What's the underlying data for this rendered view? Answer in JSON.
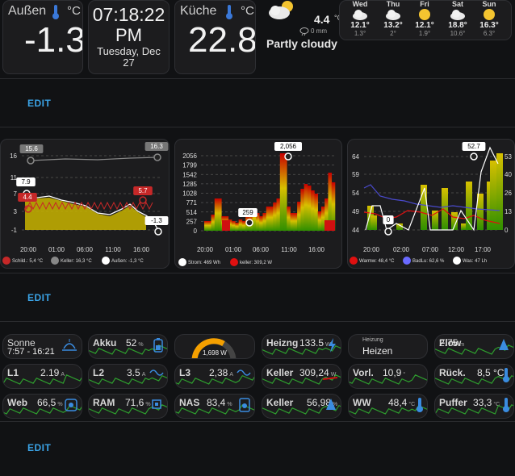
{
  "top": {
    "outdoor": {
      "label": "Außen",
      "unit": "°C",
      "value": "-1.3"
    },
    "clock": {
      "time": "07:18:22",
      "ampm": "PM",
      "date": "Tuesday, Dec",
      "day": "27"
    },
    "kitchen": {
      "label": "Küche",
      "unit": "°C",
      "value": "22.8"
    },
    "weather": {
      "temp": "4.4",
      "temp_unit": "°C",
      "precip": "0 mm",
      "condition": "Partly cloudy",
      "forecast": [
        {
          "day": "Wed",
          "hi": "12.1°",
          "lo": "1.3°",
          "icon": "cloudy-icon"
        },
        {
          "day": "Thu",
          "hi": "13.2°",
          "lo": "2°",
          "icon": "cloudy-icon"
        },
        {
          "day": "Fri",
          "hi": "12.1°",
          "lo": "1.9°",
          "icon": "sunny-icon"
        },
        {
          "day": "Sat",
          "hi": "18.8°",
          "lo": "10.6°",
          "icon": "cloudy-icon"
        },
        {
          "day": "Sun",
          "hi": "16.3°",
          "lo": "6.3°",
          "icon": "sunny-icon"
        }
      ]
    }
  },
  "edit_label": "EDIT",
  "charts": [
    {
      "yticks": [
        "16",
        "11",
        "7",
        "3",
        "-1"
      ],
      "xticks": [
        "20:00",
        "01:00",
        "06:00",
        "11:00",
        "16:00"
      ],
      "badges": [
        "15.6",
        "16.3",
        "7.9",
        "4.4",
        "5.7",
        "-1.3"
      ],
      "legend": [
        {
          "label": "Schild.: 5,4 °C",
          "color": "#c62828"
        },
        {
          "label": "Keller: 16,3 °C",
          "color": "#888888"
        },
        {
          "label": "Außen: -1,3 °C",
          "color": "#ffffff"
        }
      ]
    },
    {
      "yticks": [
        "2056",
        "1799",
        "1542",
        "1285",
        "1028",
        "771",
        "514",
        "257",
        "0"
      ],
      "xticks": [
        "20:00",
        "01:00",
        "06:00",
        "11:00",
        "16:00"
      ],
      "badges": [
        "2,056",
        "259"
      ],
      "legend": [
        {
          "label": "Strom: 469 Wh",
          "color": "#ffffff"
        },
        {
          "label": "keller: 309,2 W",
          "color": "#e01010"
        }
      ]
    },
    {
      "yticks_left": [
        "64",
        "59",
        "54",
        "49",
        "44"
      ],
      "yticks_right": [
        "53",
        "40",
        "26",
        "13",
        "0"
      ],
      "xticks": [
        "20:00",
        "02:00",
        "07:00",
        "12:00",
        "17:00"
      ],
      "badges": [
        "52.7",
        "0"
      ],
      "legend": [
        {
          "label": "Warmw: 48,4 °C",
          "color": "#e01010"
        },
        {
          "label": "BadLu: 62,6 %",
          "color": "#6a6aff"
        },
        {
          "label": "Was: 47 Lh",
          "color": "#ffffff"
        }
      ]
    }
  ],
  "tiles_row1": [
    {
      "label": "Sonne",
      "value": "7:57 - 16:21",
      "unit": ""
    },
    {
      "label": "Akku",
      "value": "52",
      "unit": "%"
    },
    {
      "label": "",
      "value": "1,698 W",
      "unit": ""
    },
    {
      "label": "Heizng",
      "value": "133.5",
      "unit": "W"
    },
    {
      "label": "Heizung",
      "value": "Heizen",
      "unit": ""
    },
    {
      "label": "Flow",
      "value": "2.75",
      "unit": "m"
    }
  ],
  "tiles_row2": [
    {
      "label": "L1",
      "value": "2.19",
      "unit": "A"
    },
    {
      "label": "L2",
      "value": "3.5",
      "unit": "A"
    },
    {
      "label": "L3",
      "value": "2,38",
      "unit": "A"
    },
    {
      "label": "Keller",
      "value": "309,24",
      "unit": "W"
    },
    {
      "label": "Vorl.",
      "value": "10,9",
      "unit": "°"
    },
    {
      "label": "Rück.",
      "value": "8,5 °C",
      "unit": ""
    }
  ],
  "tiles_row3": [
    {
      "label": "Web",
      "value": "66,5",
      "unit": "%"
    },
    {
      "label": "RAM",
      "value": "71,6",
      "unit": "%"
    },
    {
      "label": "NAS",
      "value": "83,4",
      "unit": "%"
    },
    {
      "label": "Keller",
      "value": "56,98",
      "unit": "%"
    },
    {
      "label": "WW",
      "value": "48,4",
      "unit": "°C"
    },
    {
      "label": "Puffer",
      "value": "33,3",
      "unit": "°C"
    }
  ],
  "colors": {
    "accent": "#3aa3e6",
    "spark": "#2e9e2e",
    "gauge": "#f5a000"
  }
}
